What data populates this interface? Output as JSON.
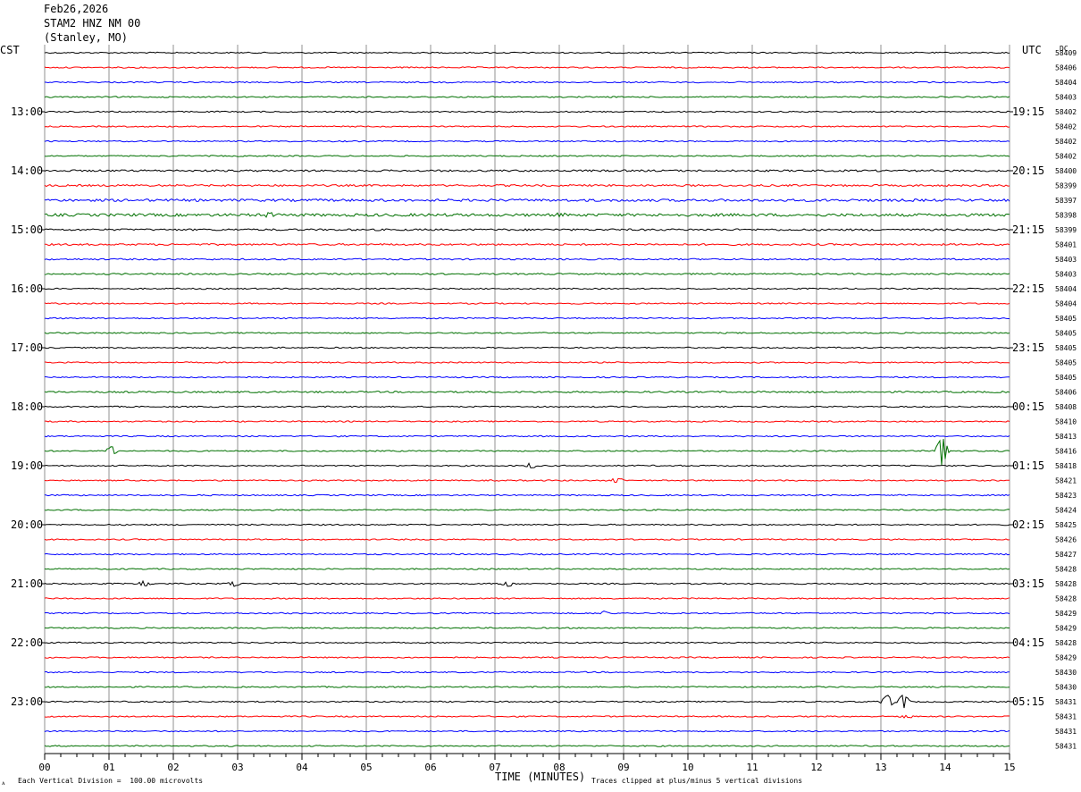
{
  "header": {
    "date": "Feb26,2026",
    "station": "STAM2 HNZ NM 00",
    "location": "(Stanley, MO)"
  },
  "left_zone_label": "CST",
  "right_zone_label": "UTC",
  "dc_label": "DC",
  "footer": {
    "scale_note": "Each Vertical Division =  100.00 microvolts",
    "xlabel": "TIME (MINUTES)",
    "clip_note": "Traces clipped at plus/minus 5 vertical divisions"
  },
  "colors": {
    "trace_cycle": [
      "#000000",
      "#ff0000",
      "#0000ff",
      "#007000"
    ],
    "grid": "#909090",
    "background": "#ffffff"
  },
  "chart_data": {
    "type": "line",
    "title": "STAM2 HNZ NM 00",
    "xlabel": "TIME (MINUTES)",
    "xlim": [
      0,
      15
    ],
    "x_ticks": [
      "00",
      "01",
      "02",
      "03",
      "04",
      "05",
      "06",
      "07",
      "08",
      "09",
      "10",
      "11",
      "12",
      "13",
      "14",
      "15"
    ],
    "trace_interval_minutes": 15,
    "left_hour_labels": [
      "13:00",
      "14:00",
      "15:00",
      "16:00",
      "17:00",
      "18:00",
      "19:00",
      "20:00",
      "21:00",
      "22:00",
      "23:00"
    ],
    "right_hour_labels": [
      "19:15",
      "20:15",
      "21:15",
      "22:15",
      "23:15",
      "00:15",
      "01:15",
      "02:15",
      "03:15",
      "04:15",
      "05:15"
    ],
    "hour_label_first_row": 4,
    "hour_label_row_step": 4,
    "dc_offsets": [
      58409,
      58406,
      58404,
      58403,
      58402,
      58402,
      58402,
      58402,
      58400,
      58399,
      58397,
      58398,
      58399,
      58401,
      58403,
      58403,
      58404,
      58404,
      58405,
      58405,
      58405,
      58405,
      58405,
      58406,
      58408,
      58410,
      58413,
      58416,
      58418,
      58421,
      58423,
      58424,
      58425,
      58426,
      58427,
      58428,
      58428,
      58428,
      58429,
      58429,
      58428,
      58429,
      58430,
      58430,
      58431,
      58431,
      58431,
      58431
    ],
    "noise_level": [
      1,
      1,
      1,
      1,
      1,
      1,
      1,
      1,
      1.5,
      1.5,
      2,
      2.2,
      1.5,
      1.4,
      1.2,
      1.2,
      1,
      1,
      1,
      1,
      1,
      1,
      1,
      1.3,
      1,
      1,
      1,
      1,
      1,
      1,
      1,
      1,
      1,
      1,
      1,
      1,
      1,
      1,
      1,
      1,
      1,
      1,
      1,
      1,
      1,
      1,
      1,
      1
    ],
    "events": [
      {
        "row": 11,
        "minute": 3.5,
        "amp": 3
      },
      {
        "row": 11,
        "minute": 8.0,
        "amp": 3
      },
      {
        "row": 27,
        "minute": 13.95,
        "amp": 16
      },
      {
        "row": 27,
        "minute": 1.05,
        "amp": 5
      },
      {
        "row": 28,
        "minute": 7.55,
        "amp": 3
      },
      {
        "row": 29,
        "minute": 8.9,
        "amp": 3
      },
      {
        "row": 36,
        "minute": 1.55,
        "amp": 3
      },
      {
        "row": 36,
        "minute": 2.95,
        "amp": 3
      },
      {
        "row": 36,
        "minute": 7.2,
        "amp": 3
      },
      {
        "row": 38,
        "minute": 8.7,
        "amp": 2
      },
      {
        "row": 44,
        "minute": 13.1,
        "amp": 8
      },
      {
        "row": 44,
        "minute": 13.35,
        "amp": 8
      },
      {
        "row": 45,
        "minute": 13.4,
        "amp": 2
      }
    ]
  }
}
